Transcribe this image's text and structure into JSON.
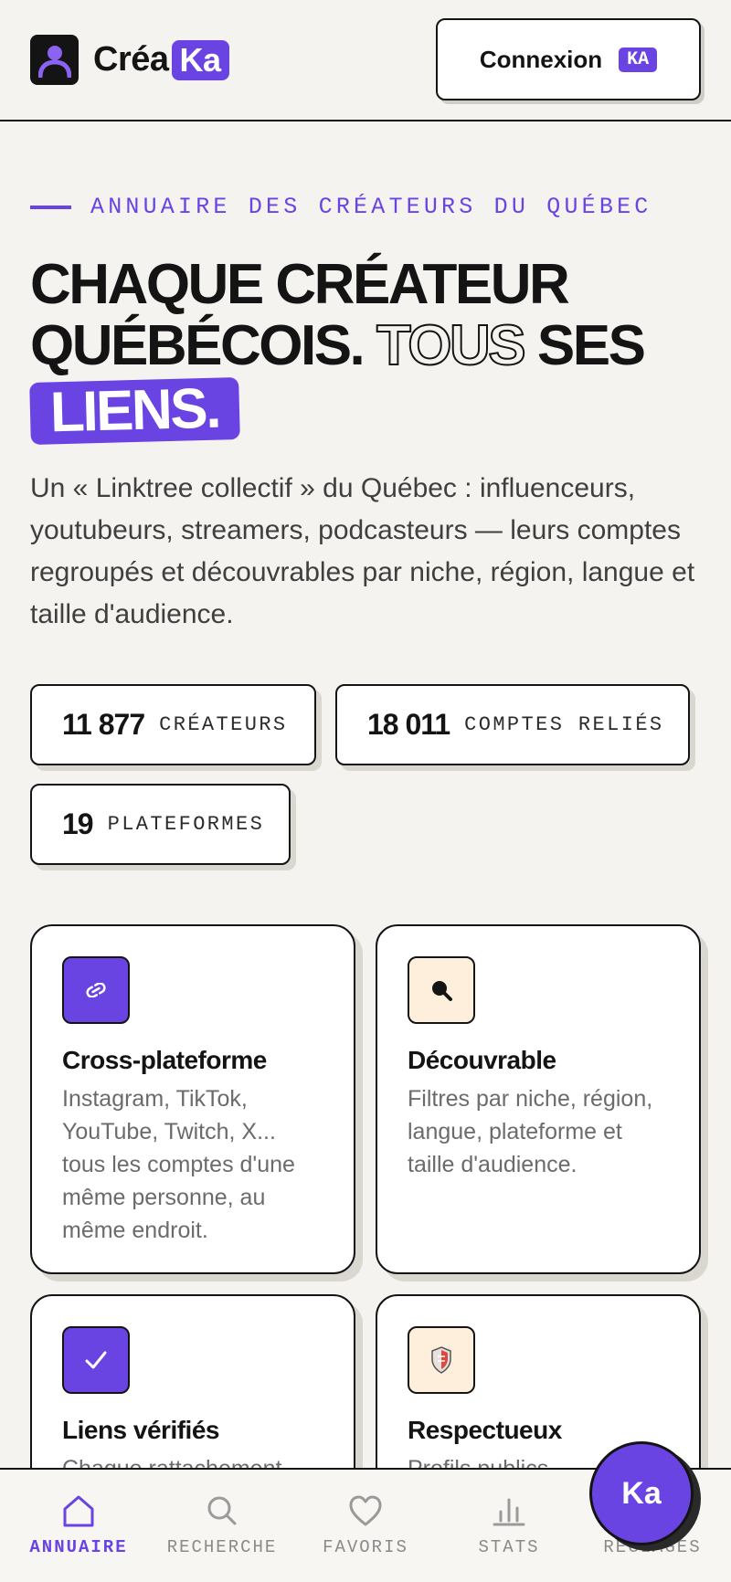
{
  "header": {
    "logo_text": "Créa",
    "logo_badge": "Ka",
    "login_label": "Connexion",
    "login_badge": "KA"
  },
  "hero": {
    "eyebrow": "ANNUAIRE DES CRÉATEURS DU QUÉBEC",
    "title_line1": "Chaque créateur",
    "title_line2a": "québécois.",
    "title_outline": "Tous",
    "title_line2b": "ses",
    "title_chip": "liens.",
    "lead": "Un « Linktree collectif » du Québec : influenceurs, youtubeurs, streamers, podcasteurs — leurs comptes regroupés et découvrables par niche, région, langue et taille d'audience."
  },
  "stats": [
    {
      "number": "11 877",
      "label": "CRÉATEURS"
    },
    {
      "number": "18 011",
      "label": "COMPTES RELIÉS"
    },
    {
      "number": "19",
      "label": "PLATEFORMES"
    }
  ],
  "features": [
    {
      "icon": "link-icon",
      "title": "Cross-plateforme",
      "description": "Instagram, TikTok, YouTube, Twitch, X... tous les comptes d'une même personne, au même endroit."
    },
    {
      "icon": "search-icon",
      "title": "Découvrable",
      "description": "Filtres par niche, région, langue, plateforme et taille d'audience."
    },
    {
      "icon": "check-icon",
      "title": "Liens vérifiés",
      "description": "Chaque rattachement"
    },
    {
      "icon": "shield-icon",
      "title": "Respectueux",
      "description": "Profils publics"
    }
  ],
  "nav": [
    {
      "icon": "home-icon",
      "label": "ANNUAIRE"
    },
    {
      "icon": "search-icon",
      "label": "RECHERCHE"
    },
    {
      "icon": "heart-icon",
      "label": "FAVORIS"
    },
    {
      "icon": "chart-icon",
      "label": "STATS"
    },
    {
      "icon": "user-icon",
      "label": "RÉGLAGES"
    }
  ],
  "fab": {
    "label": "Ka"
  },
  "colors": {
    "accent": "#6a43e3",
    "background": "#f4f3ef",
    "ink": "#141414",
    "cream": "#fdefdc"
  }
}
